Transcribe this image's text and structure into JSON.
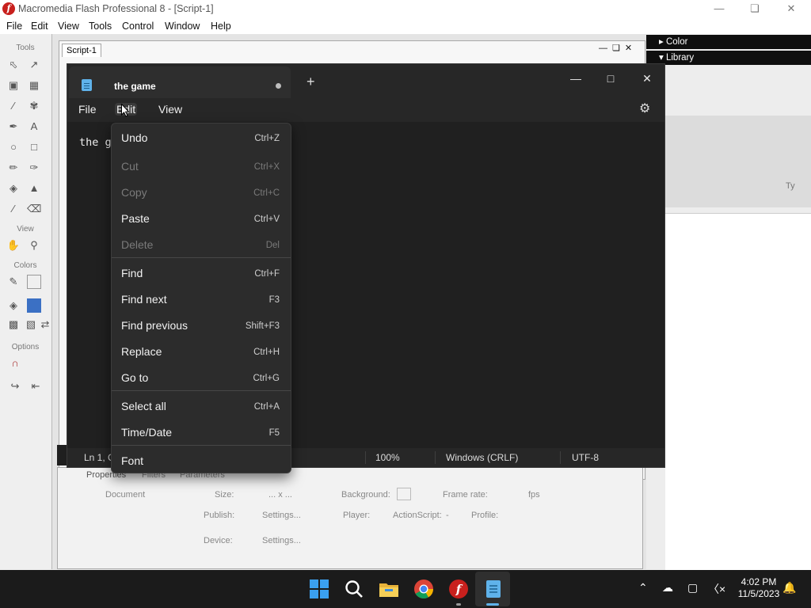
{
  "flash": {
    "title": "Macromedia Flash Professional 8 - [Script-1]",
    "menus": [
      "File",
      "Edit",
      "View",
      "Tools",
      "Control",
      "Window",
      "Help"
    ],
    "tools_heading": "Tools",
    "view_heading": "View",
    "colors_heading": "Colors",
    "options_heading": "Options",
    "doc_tab": "Script-1",
    "right_panels": {
      "color": "Color",
      "library": "Library",
      "type_col": "Ty"
    },
    "properties": {
      "tabs": [
        "Properties",
        "Filters",
        "Parameters"
      ],
      "document": "Document",
      "size_label": "Size:",
      "size_value": "... x ...",
      "background_label": "Background:",
      "frame_rate_label": "Frame rate:",
      "fps": "fps",
      "publish_label": "Publish:",
      "settings_button": "Settings...",
      "player_label": "Player:",
      "actionscript_label": "ActionScript:",
      "actionscript_value": "-",
      "profile_label": "Profile:",
      "device_label": "Device:",
      "device_settings": "Settings..."
    }
  },
  "notepad": {
    "tab_title": "the game",
    "menus": {
      "file": "File",
      "edit": "Edit",
      "view": "View"
    },
    "editor_text": "the game",
    "status": {
      "position": "Ln 1, Col 9",
      "zoom": "100%",
      "line_ending": "Windows (CRLF)",
      "encoding": "UTF-8"
    }
  },
  "edit_menu": {
    "items": [
      {
        "label": "Undo",
        "shortcut": "Ctrl+Z",
        "enabled": true
      },
      {
        "label": "Cut",
        "shortcut": "Ctrl+X",
        "enabled": false
      },
      {
        "label": "Copy",
        "shortcut": "Ctrl+C",
        "enabled": false
      },
      {
        "label": "Paste",
        "shortcut": "Ctrl+V",
        "enabled": true
      },
      {
        "label": "Delete",
        "shortcut": "Del",
        "enabled": false
      },
      {
        "label": "Find",
        "shortcut": "Ctrl+F",
        "enabled": true
      },
      {
        "label": "Find next",
        "shortcut": "F3",
        "enabled": true
      },
      {
        "label": "Find previous",
        "shortcut": "Shift+F3",
        "enabled": true
      },
      {
        "label": "Replace",
        "shortcut": "Ctrl+H",
        "enabled": true
      },
      {
        "label": "Go to",
        "shortcut": "Ctrl+G",
        "enabled": true
      },
      {
        "label": "Select all",
        "shortcut": "Ctrl+A",
        "enabled": true
      },
      {
        "label": "Time/Date",
        "shortcut": "F5",
        "enabled": true
      },
      {
        "label": "Font",
        "shortcut": "",
        "enabled": true
      }
    ]
  },
  "taskbar": {
    "time": "4:02 PM",
    "date": "11/5/2023"
  },
  "colors": {
    "notepad_bg": "#272727",
    "editor_bg": "#202020",
    "menu_bg": "#2c2c2c",
    "accent": "#5fb2ea",
    "flash_red": "#c8201d"
  }
}
